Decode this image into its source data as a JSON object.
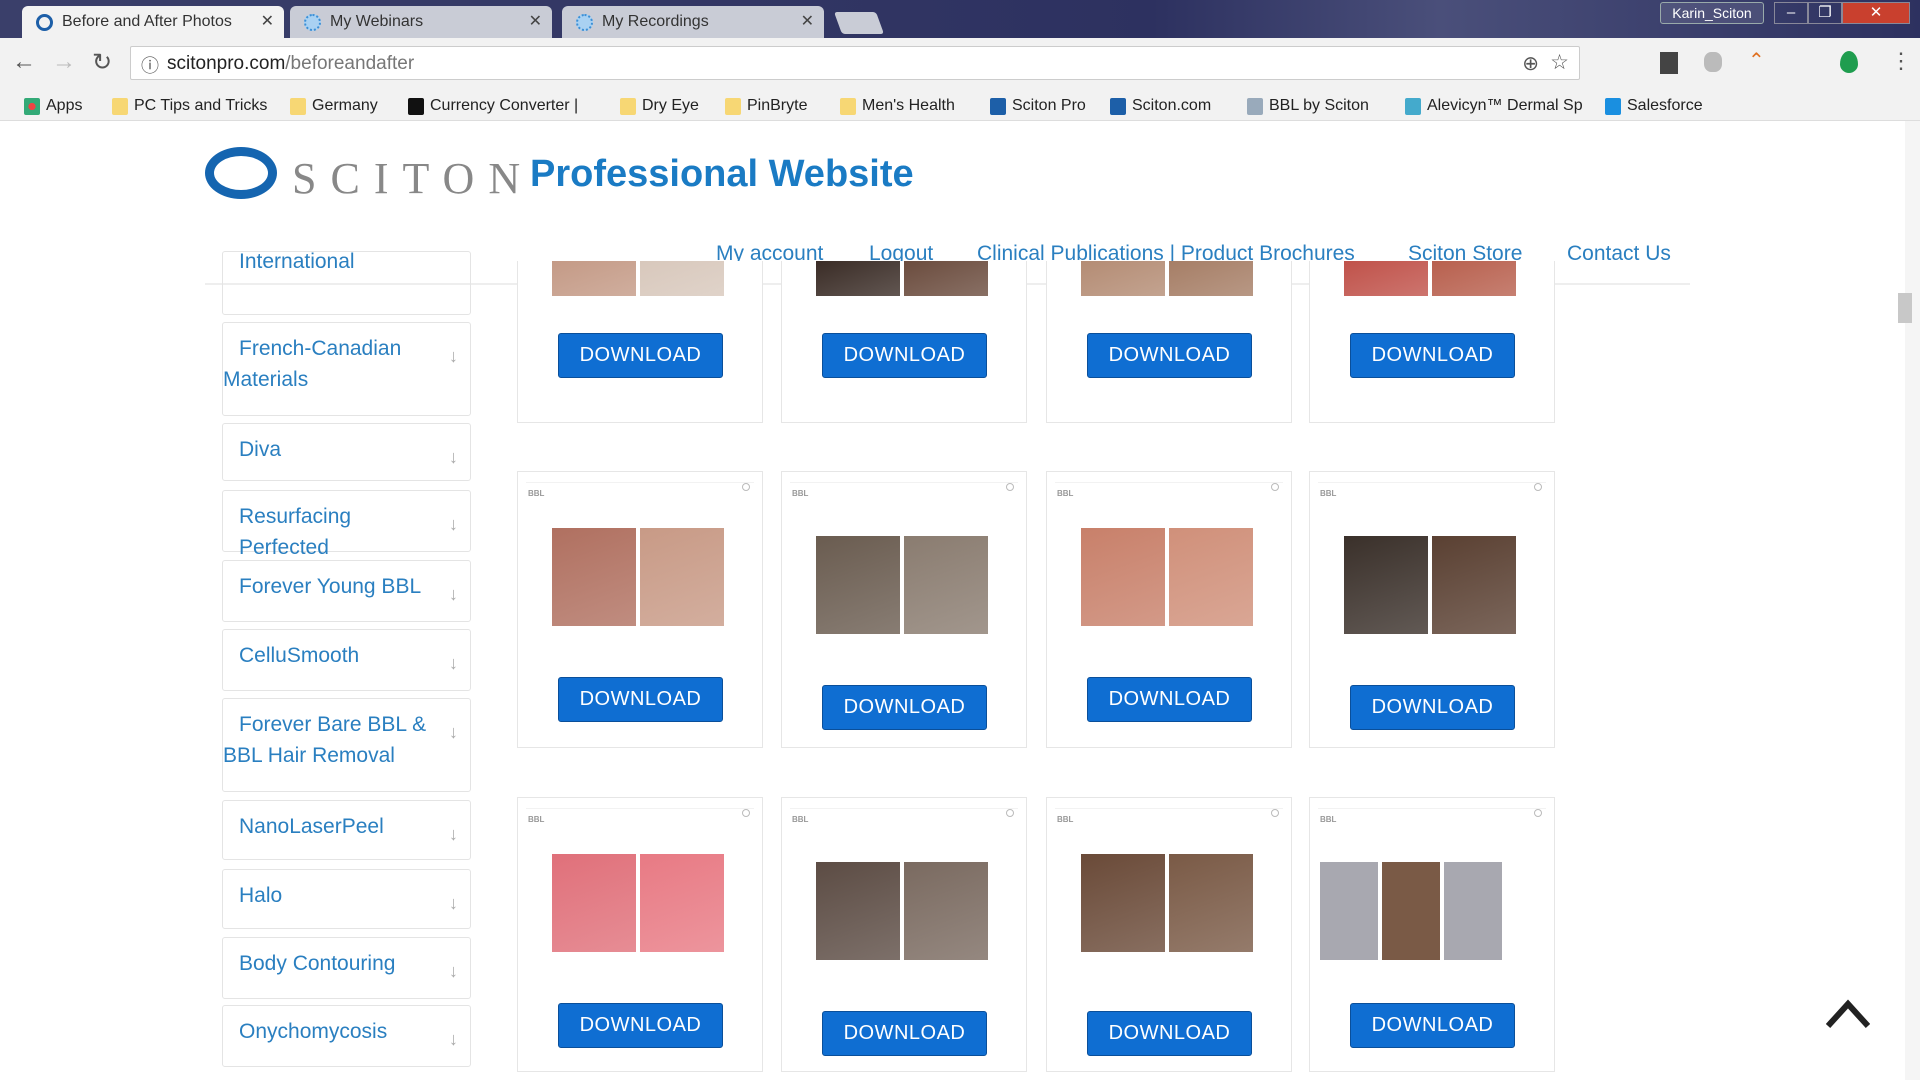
{
  "browser": {
    "tabs": [
      {
        "title": "Before and After Photos",
        "active": true
      },
      {
        "title": "My Webinars"
      },
      {
        "title": "My Recordings"
      }
    ],
    "user": "Karin_Sciton",
    "url_host": "scitonpro.com",
    "url_path": "/beforeandafter",
    "bookmarks": [
      "Apps",
      "PC Tips and Tricks",
      "Germany",
      "Currency Converter |",
      "Dry Eye",
      "PinBryte",
      "Men's Health",
      "Sciton Pro",
      "Sciton.com",
      "BBL by Sciton",
      "Alevicyn™ Dermal Sp",
      "Salesforce"
    ]
  },
  "header": {
    "logo": "SCITON",
    "title": "Professional Website",
    "nav": [
      "My account",
      "Logout",
      "Clinical Publications | Product Brochures",
      "Sciton Store",
      "Contact Us"
    ]
  },
  "sidebar": {
    "items": [
      "International",
      "French-Canadian Materials",
      "Diva",
      "Resurfacing Perfected",
      "Forever Young BBL",
      "CelluSmooth",
      "Forever Bare BBL & BBL Hair Removal",
      "NanoLaserPeel",
      "Halo",
      "Body Contouring",
      "Onychomycosis"
    ]
  },
  "grid": {
    "download_label": "DOWNLOAD",
    "card_label": "BBL",
    "photo_tones": [
      [
        "#c49a86",
        "#d8c8bc"
      ],
      [
        "#3a2c26",
        "#6b4c3e"
      ],
      [
        "#b48c74",
        "#a67e66"
      ],
      [
        "#c0524a",
        "#b8604e"
      ],
      [
        "#b07060",
        "#c89a86"
      ],
      [
        "#6a5c50",
        "#8a7c70"
      ],
      [
        "#c8806a",
        "#d0907a"
      ],
      [
        "#3a302a",
        "#5a4032"
      ],
      [
        "#e0707a",
        "#e87a84"
      ],
      [
        "#5c4c44",
        "#7a6a60"
      ],
      [
        "#6a4a38",
        "#7a5a46"
      ],
      [
        "#9aa0a8",
        "#7a6a5c"
      ]
    ]
  },
  "colors": {
    "accent": "#1a7bc4",
    "button": "#0f6ed2"
  }
}
